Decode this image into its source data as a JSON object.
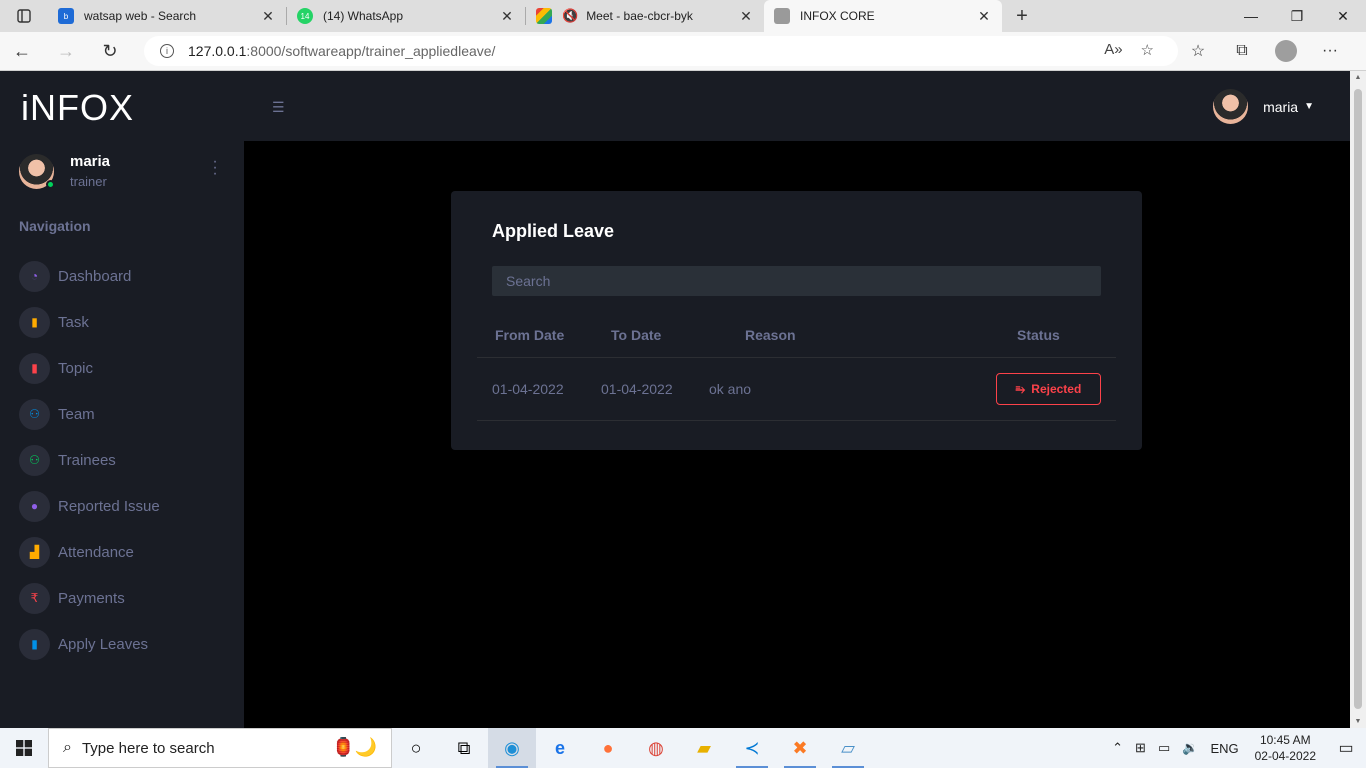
{
  "browser": {
    "tabs": [
      {
        "title": "watsap web - Search",
        "icon": "bing-icon",
        "color": "#1e6bd6",
        "active": false
      },
      {
        "title": "(14) WhatsApp",
        "icon": "whatsapp-icon",
        "badge": "14",
        "color": "#25d366",
        "active": false
      },
      {
        "title": "Meet - bae-cbcr-byk",
        "icon": "meet-icon",
        "color": "#00897b",
        "active": false
      },
      {
        "title": "INFOX CORE",
        "icon": "page-icon",
        "color": "#888888",
        "active": true
      }
    ],
    "url_host": "127.0.0.1",
    "url_path": ":8000/softwareapp/trainer_appliedleave/"
  },
  "sidebar": {
    "brand": "iNFOX",
    "profile": {
      "name": "maria",
      "role": "trainer"
    },
    "nav_heading": "Navigation",
    "items": [
      {
        "label": "Dashboard",
        "icon": "speedometer-icon",
        "color": "#8f5fe8"
      },
      {
        "label": "Task",
        "icon": "clipboard-icon",
        "color": "#ffab00"
      },
      {
        "label": "Topic",
        "icon": "book-icon",
        "color": "#fc424a"
      },
      {
        "label": "Team",
        "icon": "users-icon",
        "color": "#0090e7"
      },
      {
        "label": "Trainees",
        "icon": "users-icon",
        "color": "#00d25b"
      },
      {
        "label": "Reported Issue",
        "icon": "alert-icon",
        "color": "#8f5fe8"
      },
      {
        "label": "Attendance",
        "icon": "bar-chart-icon",
        "color": "#ffab00"
      },
      {
        "label": "Payments",
        "icon": "rupee-icon",
        "color": "#fc424a"
      },
      {
        "label": "Apply Leaves",
        "icon": "notebook-icon",
        "color": "#0090e7"
      }
    ]
  },
  "topnav": {
    "user_name": "maria"
  },
  "leave": {
    "title": "Applied Leave",
    "search_placeholder": "Search",
    "columns": {
      "from": "From Date",
      "to": "To Date",
      "reason": "Reason",
      "status": "Status"
    },
    "rows": [
      {
        "from": "01-04-2022",
        "to": "01-04-2022",
        "reason": "ok ano",
        "status": "Rejected"
      }
    ]
  },
  "taskbar": {
    "search_placeholder": "Type here to search",
    "lang": "ENG",
    "time": "10:45 AM",
    "date": "02-04-2022"
  }
}
